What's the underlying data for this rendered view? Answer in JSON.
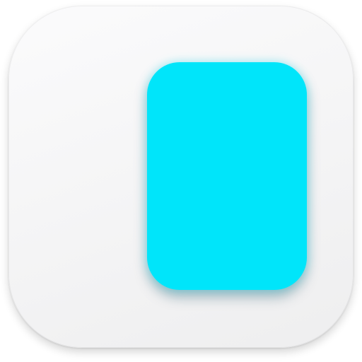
{
  "icon": {
    "tile_icon": "rounded-square-app-tile",
    "panel_icon": "rounded-rectangle-panel",
    "colors": {
      "tile": "#f4f4f5",
      "panel": "#00e5fa"
    }
  }
}
